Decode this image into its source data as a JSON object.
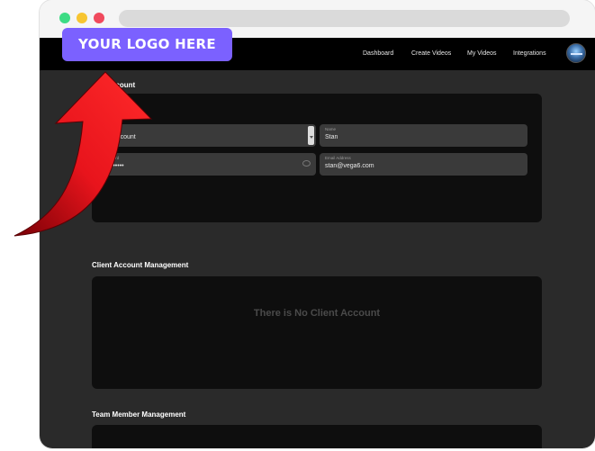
{
  "nav": {
    "items": [
      {
        "label": "Dashboard"
      },
      {
        "label": "Create Videos"
      },
      {
        "label": "My Videos"
      },
      {
        "label": "Integrations"
      }
    ]
  },
  "account": {
    "title_fragment": "ccount",
    "fields": {
      "type_value": "nt Account",
      "name_label": "Name",
      "name_value": "Stan",
      "password_label": "ssword",
      "password_value": "••••••••",
      "email_label": "Email Address",
      "email_value": "stan@vega6.com"
    }
  },
  "client_management": {
    "title": "Client Account Management",
    "empty_message": "There is No Client Account"
  },
  "team_management": {
    "title": "Team Member Management"
  },
  "logo_badge": {
    "text": "YOUR LOGO HERE",
    "color": "#7b61ff"
  },
  "colors": {
    "arrow": "#e8141c",
    "nav_bg": "#000000",
    "page_bg": "#2a2a2a"
  }
}
